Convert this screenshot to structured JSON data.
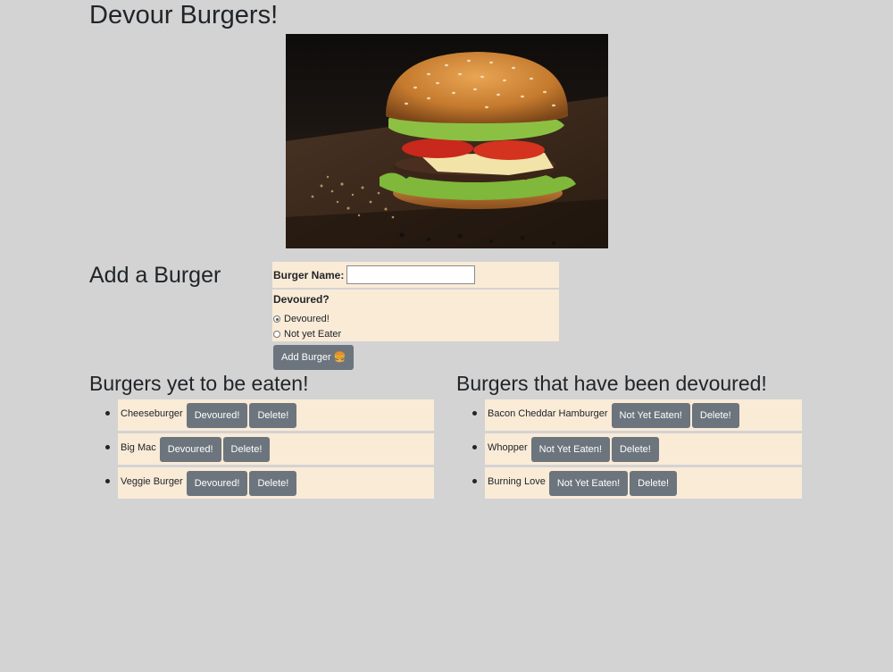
{
  "page": {
    "title": "Devour Burgers!"
  },
  "hero": {
    "icon": "burger-photo"
  },
  "form": {
    "heading": "Add a Burger",
    "name_label": "Burger Name:",
    "name_value": "",
    "devoured_question": "Devoured?",
    "options": [
      {
        "label": "Devoured!",
        "checked": true
      },
      {
        "label": "Not yet Eater",
        "checked": false
      }
    ],
    "submit_label": "Add Burger 🍔"
  },
  "uneaten": {
    "heading": "Burgers yet to be eaten!",
    "items": [
      {
        "name": "Cheeseburger",
        "action": "Devoured!",
        "delete": "Delete!"
      },
      {
        "name": "Big Mac",
        "action": "Devoured!",
        "delete": "Delete!"
      },
      {
        "name": "Veggie Burger",
        "action": "Devoured!",
        "delete": "Delete!"
      }
    ]
  },
  "devoured": {
    "heading": "Burgers that have been devoured!",
    "items": [
      {
        "name": "Bacon Cheddar Hamburger",
        "action": "Not Yet Eaten!",
        "delete": "Delete!"
      },
      {
        "name": "Whopper",
        "action": "Not Yet Eaten!",
        "delete": "Delete!"
      },
      {
        "name": "Burning Love",
        "action": "Not Yet Eaten!",
        "delete": "Delete!"
      }
    ]
  },
  "colors": {
    "background": "#d3d3d3",
    "panel": "#faebd7",
    "button": "#6c757d"
  }
}
